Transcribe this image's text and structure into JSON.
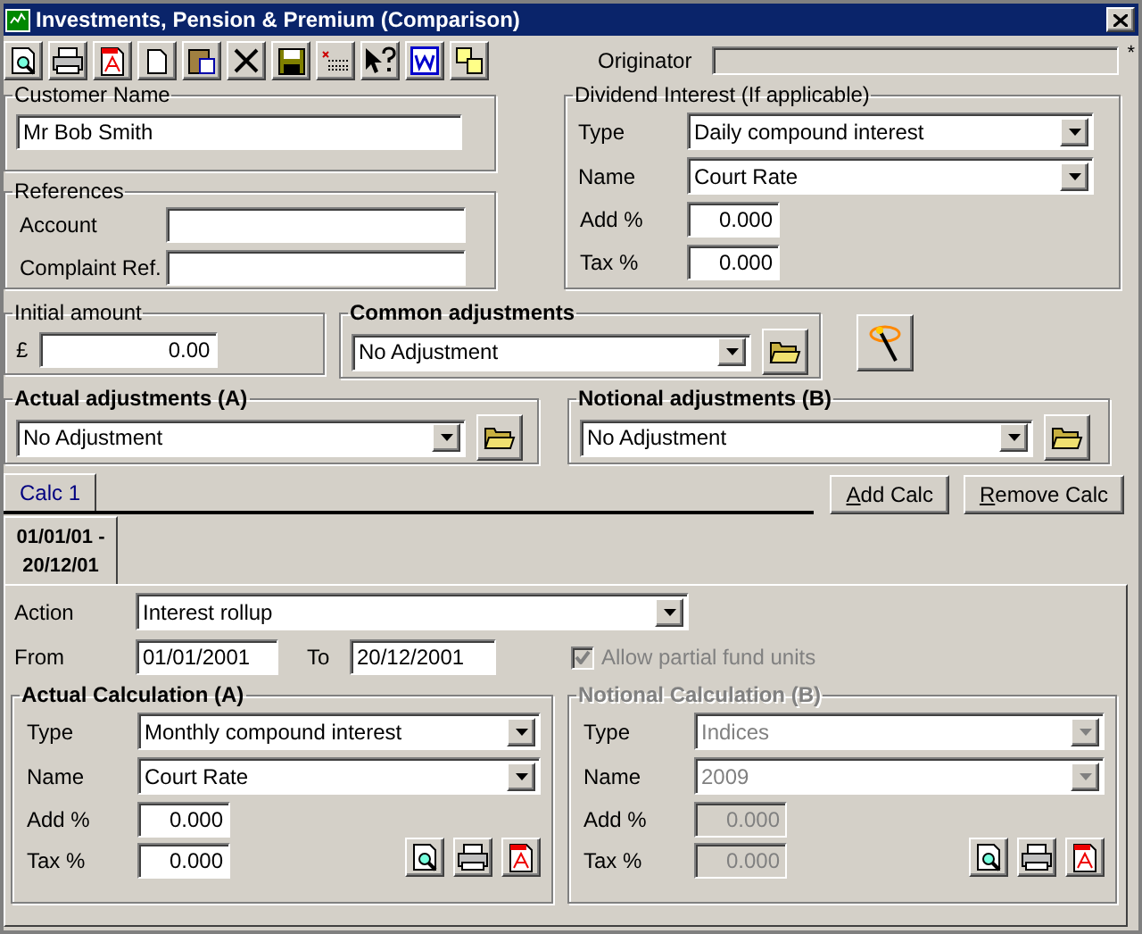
{
  "window": {
    "title": "Investments, Pension & Premium (Comparison)"
  },
  "toolbar": {
    "originator": {
      "label": "Originator",
      "marker": "*"
    }
  },
  "customer_name": {
    "title": "Customer Name",
    "value": "Mr Bob Smith"
  },
  "references": {
    "title": "References",
    "fields": [
      {
        "label": "Account"
      },
      {
        "label": "Complaint Ref."
      }
    ]
  },
  "dividend_interest": {
    "title": "Dividend Interest (If applicable)",
    "type": {
      "label": "Type",
      "value": "Daily compound interest"
    },
    "name": {
      "label": "Name",
      "value": "Court Rate"
    },
    "add": {
      "label": "Add %",
      "value": "0.000"
    },
    "tax": {
      "label": "Tax %",
      "value": "0.000"
    }
  },
  "initial_amount": {
    "title": "Initial amount",
    "currency": "£",
    "value": "0.00"
  },
  "common_adjustments": {
    "title": "Common adjustments",
    "value": "No Adjustment"
  },
  "actual_adjustments": {
    "title": "Actual adjustments (A)",
    "value": "No Adjustment"
  },
  "notional_adjustments": {
    "title": "Notional adjustments (B)",
    "value": "No Adjustment"
  },
  "calc_tabs": [
    {
      "label": "Calc 1",
      "selected": true
    }
  ],
  "buttons": [
    {
      "label": "Add Calc"
    },
    {
      "label": "Remove Calc"
    }
  ],
  "periods": [
    {
      "label": "01/01/01 - 20/12/01",
      "selected": true
    }
  ],
  "calc": {
    "action": {
      "label": "Action",
      "value": "Interest rollup"
    },
    "from": {
      "label": "From",
      "value": "01/01/2001"
    },
    "to": {
      "label": "To",
      "value": "20/12/2001"
    },
    "allow_partial": {
      "label": "Allow partial fund units",
      "checked": true,
      "disabled": true
    },
    "actual": {
      "title": "Actual Calculation (A)",
      "disabled": false,
      "type": {
        "label": "Type",
        "value": "Monthly compound interest"
      },
      "name": {
        "label": "Name",
        "value": "Court Rate"
      },
      "add": {
        "label": "Add %",
        "value": "0.000"
      },
      "tax": {
        "label": "Tax %",
        "value": "0.000"
      }
    },
    "notional": {
      "title": "Notional Calculation (B)",
      "disabled": true,
      "type": {
        "label": "Type",
        "value": "Indices"
      },
      "name": {
        "label": "Name",
        "value": "2009"
      },
      "add": {
        "label": "Add %",
        "value": "0.000"
      },
      "tax": {
        "label": "Tax %",
        "value": "0.000"
      }
    }
  }
}
